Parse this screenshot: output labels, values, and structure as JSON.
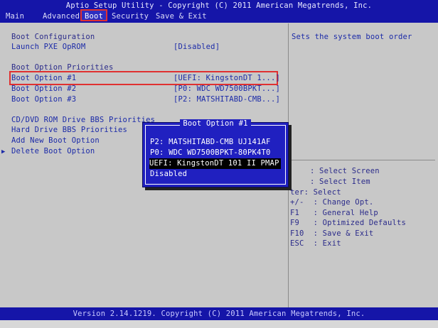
{
  "title": "Aptio Setup Utility - Copyright (C) 2011 American Megatrends, Inc.",
  "tabs": [
    "Main",
    "Advanced",
    "Boot",
    "Security",
    "Save & Exit"
  ],
  "active_tab": "Boot",
  "left": {
    "boot_configuration": "Boot Configuration",
    "launch_pxe_label": "Launch PXE OpROM",
    "launch_pxe_value": "[Disabled]",
    "boot_option_priorities": "Boot Option Priorities",
    "options": [
      {
        "label": "Boot Option #1",
        "value": "[UEFI: KingstonDT 1...]"
      },
      {
        "label": "Boot Option #2",
        "value": "[P0: WDC WD7500BPKT...]"
      },
      {
        "label": "Boot Option #3",
        "value": "[P2: MATSHITABD-CMB...]"
      }
    ],
    "cd_dvd": "CD/DVD ROM Drive BBS Priorities",
    "hard_drive": "Hard Drive BBS Priorities",
    "add_new": "Add New Boot Option",
    "delete": "Delete Boot Option",
    "arrow": "▶"
  },
  "help": {
    "description": "Sets the system boot order",
    "keys": [
      ": Select Screen",
      ": Select Item",
      "ter: Select",
      "+/-  : Change Opt.",
      "F1   : General Help",
      "F9   : Optimized Defaults",
      "F10  : Save & Exit",
      "ESC  : Exit"
    ]
  },
  "popup": {
    "title": "Boot Option #1",
    "items": [
      "P2: MATSHITABD-CMB UJ141AF",
      "P0: WDC WD7500BPKT-80PK4T0",
      "UEFI: KingstonDT 101 II PMAP",
      "Disabled"
    ]
  },
  "footer": "Version 2.14.1219. Copyright (C) 2011 American Megatrends, Inc."
}
